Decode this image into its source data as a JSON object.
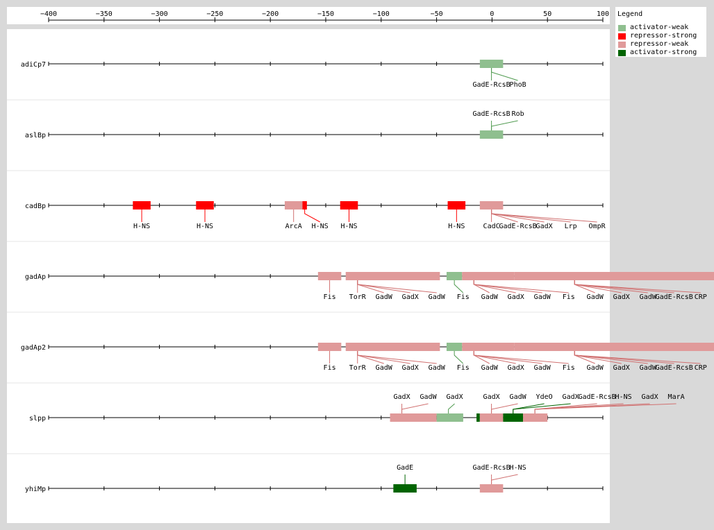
{
  "legend": {
    "title": "Legend",
    "items": [
      {
        "label": "activator-weak",
        "color": "#8fbf8f"
      },
      {
        "label": "repressor-strong",
        "color": "#ff0000"
      },
      {
        "label": "repressor-weak",
        "color": "#e09a9a"
      },
      {
        "label": "activator-strong",
        "color": "#006400"
      }
    ]
  },
  "axis": {
    "ticks": [
      -400,
      -350,
      -300,
      -250,
      -200,
      -150,
      -100,
      -50,
      0,
      50,
      100
    ],
    "range": [
      -400,
      100
    ]
  },
  "promoters": [
    {
      "name": "adiCp7",
      "sites": [
        {
          "start": -11,
          "end": 10,
          "type": "activator-weak",
          "labels": [
            "GadE-RcsB",
            "PhoB"
          ]
        }
      ],
      "labels_above": false
    },
    {
      "name": "aslBp",
      "sites": [
        {
          "start": -11,
          "end": 10,
          "type": "activator-weak",
          "labels": [
            "GadE-RcsB",
            "Rob"
          ]
        }
      ],
      "labels_above": true
    },
    {
      "name": "cadBp",
      "sites": [
        {
          "start": -324,
          "end": -308,
          "type": "repressor-strong",
          "labels": [
            "H-NS"
          ]
        },
        {
          "start": -267,
          "end": -251,
          "type": "repressor-strong",
          "labels": [
            "H-NS"
          ]
        },
        {
          "start": -187,
          "end": -171,
          "type": "repressor-weak",
          "labels": [
            "ArcA"
          ]
        },
        {
          "start": -171,
          "end": -167,
          "type": "repressor-strong",
          "labels": [
            "H-NS"
          ]
        },
        {
          "start": -137,
          "end": -121,
          "type": "repressor-strong",
          "labels": [
            "H-NS"
          ]
        },
        {
          "start": -40,
          "end": -24,
          "type": "repressor-strong",
          "labels": [
            "H-NS"
          ]
        },
        {
          "start": -11,
          "end": 10,
          "type": "repressor-weak",
          "labels": [
            "CadC",
            "GadE-RcsB",
            "GadX",
            "Lrp",
            "OmpR"
          ]
        }
      ],
      "labels_above": false
    },
    {
      "name": "gadAp",
      "sites": [
        {
          "start": -157,
          "end": -136,
          "type": "repressor-weak",
          "labels": [
            "Fis"
          ]
        },
        {
          "start": -132,
          "end": -47,
          "type": "repressor-weak",
          "labels": [
            "TorR",
            "GadW",
            "GadX",
            "GadW"
          ]
        },
        {
          "start": -41,
          "end": -27,
          "type": "activator-weak",
          "labels": [
            "Fis"
          ]
        },
        {
          "start": -27,
          "end": 20,
          "type": "repressor-weak",
          "labels": [
            "GadW",
            "GadX",
            "GadW",
            "Fis"
          ]
        },
        {
          "start": 20,
          "end": 300,
          "type": "repressor-weak",
          "labels": []
        },
        {
          "start": 69,
          "end": 80,
          "type": "repressor-weak",
          "labels": [
            "GadW",
            "GadX",
            "GadW",
            "GadE-RcsB",
            "CRP"
          ]
        }
      ],
      "labels_above": false
    },
    {
      "name": "gadAp2",
      "sites": [
        {
          "start": -157,
          "end": -136,
          "type": "repressor-weak",
          "labels": [
            "Fis"
          ]
        },
        {
          "start": -132,
          "end": -47,
          "type": "repressor-weak",
          "labels": [
            "TorR",
            "GadW",
            "GadX",
            "GadW"
          ]
        },
        {
          "start": -41,
          "end": -27,
          "type": "activator-weak",
          "labels": [
            "Fis"
          ]
        },
        {
          "start": -27,
          "end": 20,
          "type": "repressor-weak",
          "labels": [
            "GadW",
            "GadX",
            "GadW",
            "Fis"
          ]
        },
        {
          "start": 20,
          "end": 300,
          "type": "repressor-weak",
          "labels": []
        },
        {
          "start": 69,
          "end": 80,
          "type": "repressor-weak",
          "labels": [
            "GadW",
            "GadX",
            "GadW",
            "GadE-RcsB",
            "CRP"
          ]
        }
      ],
      "labels_above": false
    },
    {
      "name": "slpp",
      "sites": [
        {
          "start": -92,
          "end": -50,
          "type": "repressor-weak",
          "labels": [
            "GadX",
            "GadW"
          ]
        },
        {
          "start": -50,
          "end": -26,
          "type": "activator-weak",
          "labels": [
            "GadX"
          ]
        },
        {
          "start": -14,
          "end": -11,
          "type": "activator-strong",
          "labels": []
        },
        {
          "start": -11,
          "end": 10,
          "type": "repressor-weak",
          "labels": [
            "GadX",
            "GadW"
          ]
        },
        {
          "start": 10,
          "end": 28,
          "type": "activator-strong",
          "labels": [
            "YdeO",
            "GadX"
          ]
        },
        {
          "start": 28,
          "end": 50,
          "type": "repressor-weak",
          "labels": [
            "GadE-RcsB",
            "H-NS",
            "GadX",
            "MarA"
          ]
        }
      ],
      "labels_above": true
    },
    {
      "name": "yhiMp",
      "sites": [
        {
          "start": -89,
          "end": -68,
          "type": "activator-strong",
          "labels": [
            "GadE"
          ]
        },
        {
          "start": -11,
          "end": 10,
          "type": "repressor-weak",
          "labels": [
            "GadE-RcsB",
            "H-NS"
          ]
        }
      ],
      "labels_above": true
    }
  ]
}
